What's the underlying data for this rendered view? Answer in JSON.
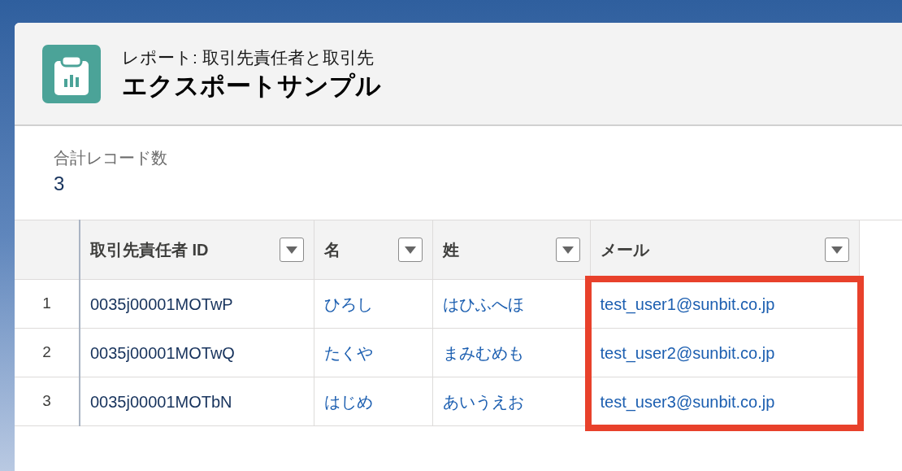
{
  "header": {
    "subtitle": "レポート: 取引先責任者と取引先",
    "title": "エクスポートサンプル"
  },
  "summary": {
    "label": "合計レコード数",
    "value": "3"
  },
  "table": {
    "columns": [
      {
        "label": "取引先責任者 ID",
        "highlighted": false
      },
      {
        "label": "名",
        "highlighted": false
      },
      {
        "label": "姓",
        "highlighted": false
      },
      {
        "label": "メール",
        "highlighted": true
      }
    ],
    "rows": [
      {
        "number": "1",
        "cells": [
          "0035j00001MOTwP",
          "ひろし",
          "はひふへほ",
          "test_user1@sunbit.co.jp"
        ]
      },
      {
        "number": "2",
        "cells": [
          "0035j00001MOTwQ",
          "たくや",
          "まみむめも",
          "test_user2@sunbit.co.jp"
        ]
      },
      {
        "number": "3",
        "cells": [
          "0035j00001MOTbN",
          "はじめ",
          "あいうえお",
          "test_user3@sunbit.co.jp"
        ]
      }
    ]
  }
}
